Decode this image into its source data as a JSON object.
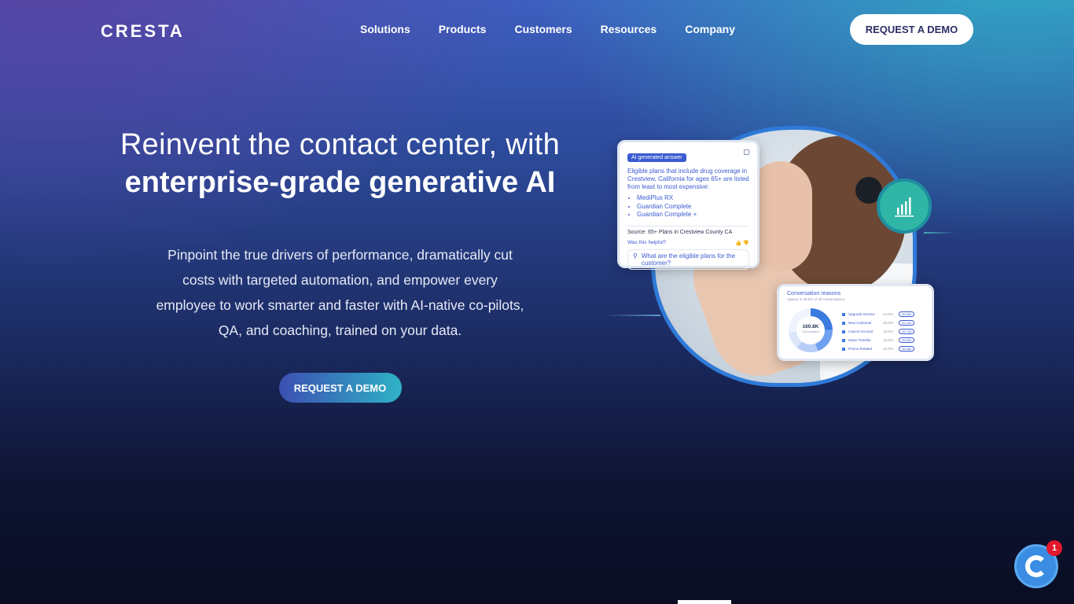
{
  "brand": {
    "logo": "CRESTA"
  },
  "nav": {
    "items": [
      {
        "label": "Solutions"
      },
      {
        "label": "Products"
      },
      {
        "label": "Customers"
      },
      {
        "label": "Resources"
      },
      {
        "label": "Company"
      }
    ],
    "cta": "REQUEST A DEMO"
  },
  "hero": {
    "headline_line1": "Reinvent the contact center, with",
    "headline_line2": "enterprise-grade generative AI",
    "subtext": "Pinpoint the true drivers of performance, dramatically cut costs with targeted automation, and empower every employee to work smarter and faster with AI-native co-pilots, QA, and coaching, trained on your data.",
    "cta": "REQUEST A DEMO"
  },
  "ai_card": {
    "tag": "AI generated answer",
    "answer": "Eligible plans that include drug coverage in Crestview, California for ages 65+ are listed from least to most expensive:",
    "plans": [
      "MediPlus RX",
      "Guardian Complete",
      "Guardian Complete +"
    ],
    "source_label": "Source:",
    "source_value": "65+ Plans in Crestview County CA",
    "helpful": "Was this helpful?",
    "question": "What are the eligible plans for the customer?"
  },
  "conv_card": {
    "title": "Conversation reasons",
    "subtitle": "Appear in 39.8% of all conversations",
    "total": "160.8K",
    "total_label": "Conversations",
    "rows": [
      {
        "name": "Upgrade Service",
        "pct": "24.5%",
        "value": "39,399"
      },
      {
        "name": "New Customer",
        "pct": "20.0%",
        "value": "32,160"
      },
      {
        "name": "Cancel Account",
        "pct": "16.0%",
        "value": "25,728"
      },
      {
        "name": "Move Transfer",
        "pct": "13.0%",
        "value": "20,904"
      },
      {
        "name": "Promo Related",
        "pct": "10.0%",
        "value": "16,080"
      }
    ]
  },
  "chat_widget": {
    "badge": "1"
  },
  "colors": {
    "accent": "#3b5bd1",
    "teal": "#2fb6a6",
    "badge_red": "#e3182d"
  }
}
